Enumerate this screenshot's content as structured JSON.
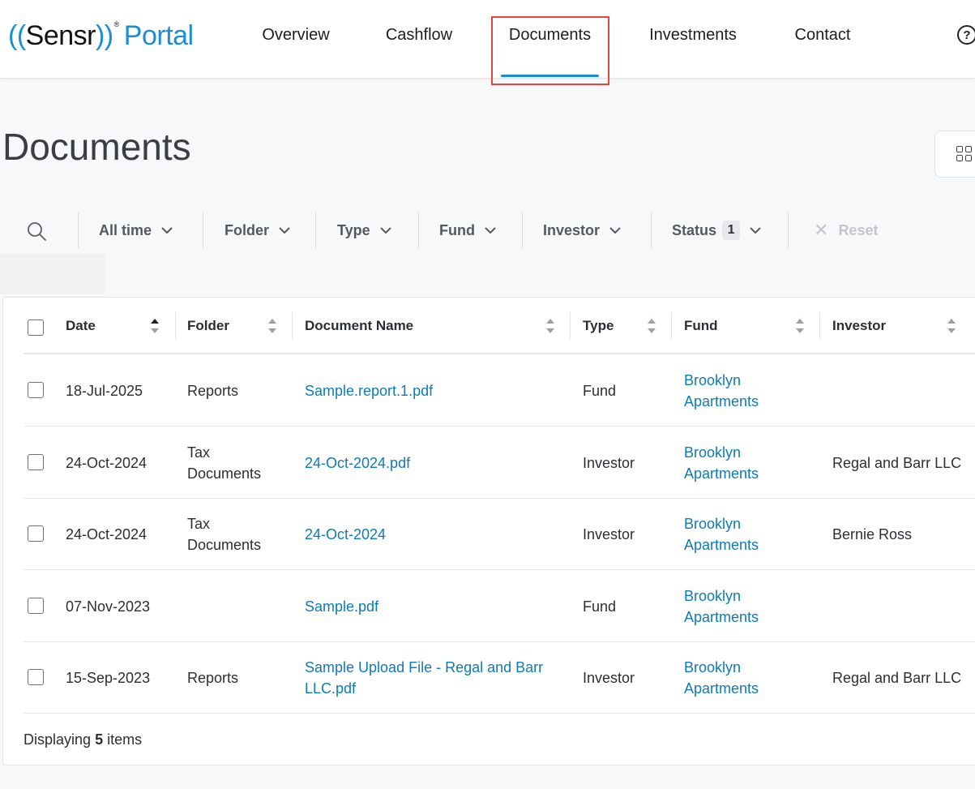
{
  "header": {
    "logo": {
      "paren_open": "((",
      "brand": "Sensr",
      "paren_close": "))",
      "reg": "®",
      "portal": "Portal"
    },
    "nav": [
      {
        "label": "Overview"
      },
      {
        "label": "Cashflow"
      },
      {
        "label": "Documents",
        "active": true
      },
      {
        "label": "Investments"
      },
      {
        "label": "Contact"
      }
    ],
    "help_icon": "question-circle-icon",
    "help_glyph": "?"
  },
  "page": {
    "title": "Documents",
    "view_icon": "grid-view-icon"
  },
  "filters": {
    "search_icon": "search-icon",
    "items": [
      {
        "label": "All time"
      },
      {
        "label": "Folder"
      },
      {
        "label": "Type"
      },
      {
        "label": "Fund"
      },
      {
        "label": "Investor"
      },
      {
        "label": "Status",
        "badge": "1"
      }
    ],
    "reset_label": "Reset",
    "reset_glyph": "✕"
  },
  "table": {
    "columns": [
      {
        "label": "Date",
        "sort": "asc"
      },
      {
        "label": "Folder",
        "sort": "none"
      },
      {
        "label": "Document Name",
        "sort": "none"
      },
      {
        "label": "Type",
        "sort": "none"
      },
      {
        "label": "Fund",
        "sort": "none"
      },
      {
        "label": "Investor",
        "sort": "none"
      }
    ],
    "rows": [
      {
        "date": "18-Jul-2025",
        "folder": "Reports",
        "name": "Sample.report.1.pdf",
        "type": "Fund",
        "fund": "Brooklyn Apartments",
        "investor": ""
      },
      {
        "date": "24-Oct-2024",
        "folder": "Tax Documents",
        "name": "24-Oct-2024.pdf",
        "type": "Investor",
        "fund": "Brooklyn Apartments",
        "investor": "Regal and Barr LLC"
      },
      {
        "date": "24-Oct-2024",
        "folder": "Tax Documents",
        "name": "24-Oct-2024",
        "type": "Investor",
        "fund": "Brooklyn Apartments",
        "investor": "Bernie Ross"
      },
      {
        "date": "07-Nov-2023",
        "folder": "",
        "name": "Sample.pdf",
        "type": "Fund",
        "fund": "Brooklyn Apartments",
        "investor": ""
      },
      {
        "date": "15-Sep-2023",
        "folder": "Reports",
        "name": "Sample Upload File - Regal and Barr LLC.pdf",
        "type": "Investor",
        "fund": "Brooklyn Apartments",
        "investor": "Regal and Barr LLC"
      }
    ],
    "footer": {
      "prefix": "Displaying",
      "count": "5",
      "suffix": "items"
    }
  },
  "colors": {
    "accent": "#1a8fd6",
    "link": "#0e7bb8",
    "highlight": "#e5443a"
  }
}
